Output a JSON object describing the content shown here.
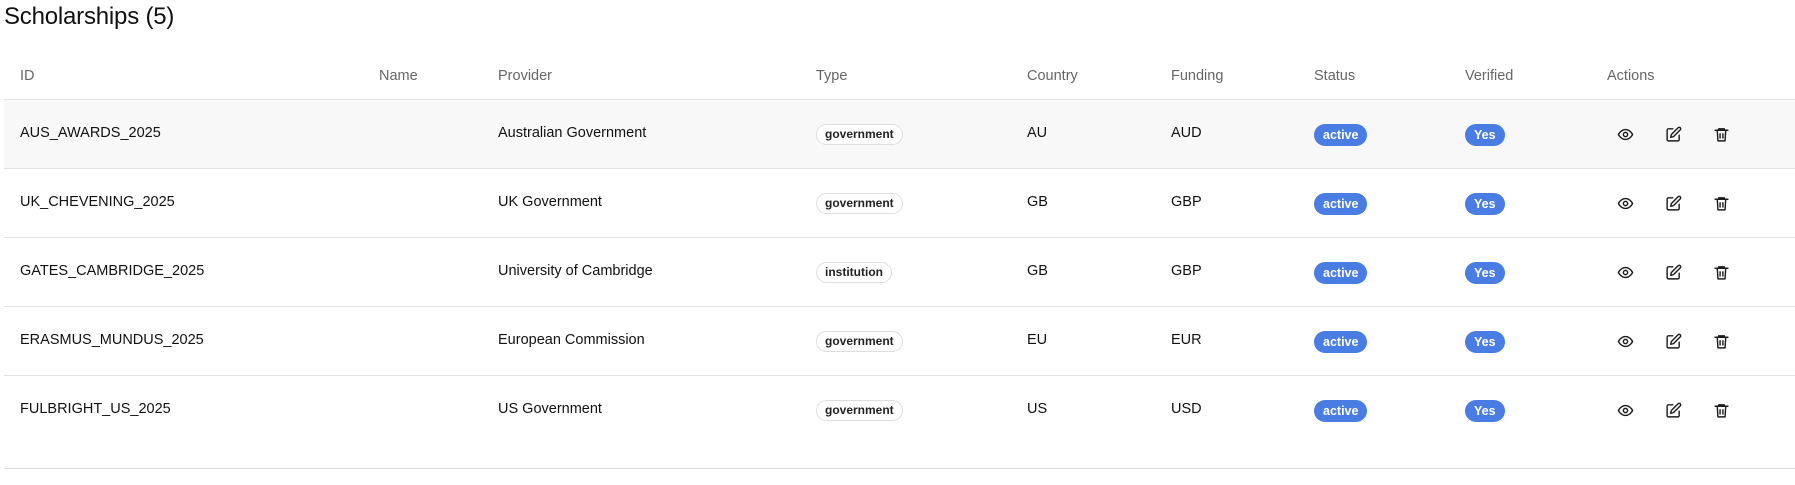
{
  "page": {
    "title": "Scholarships (5)"
  },
  "table": {
    "columns": {
      "id": "ID",
      "name": "Name",
      "provider": "Provider",
      "type": "Type",
      "country": "Country",
      "funding": "Funding",
      "status": "Status",
      "verified": "Verified",
      "actions": "Actions"
    },
    "rows": [
      {
        "id": "AUS_AWARDS_2025",
        "name": "",
        "provider": "Australian Government",
        "type": "government",
        "country": "AU",
        "funding": "AUD",
        "status": "active",
        "verified": "Yes"
      },
      {
        "id": "UK_CHEVENING_2025",
        "name": "",
        "provider": "UK Government",
        "type": "government",
        "country": "GB",
        "funding": "GBP",
        "status": "active",
        "verified": "Yes"
      },
      {
        "id": "GATES_CAMBRIDGE_2025",
        "name": "",
        "provider": "University of Cambridge",
        "type": "institution",
        "country": "GB",
        "funding": "GBP",
        "status": "active",
        "verified": "Yes"
      },
      {
        "id": "ERASMUS_MUNDUS_2025",
        "name": "",
        "provider": "European Commission",
        "type": "government",
        "country": "EU",
        "funding": "EUR",
        "status": "active",
        "verified": "Yes"
      },
      {
        "id": "FULBRIGHT_US_2025",
        "name": "",
        "provider": "US Government",
        "type": "government",
        "country": "US",
        "funding": "USD",
        "status": "active",
        "verified": "Yes"
      }
    ],
    "row_actions": [
      "eye-icon",
      "edit-icon",
      "trash-icon"
    ]
  },
  "colors": {
    "accent": "#4a7de4",
    "header_text": "#666666",
    "row_highlight": "#f8f8f8",
    "divider": "#e2e2e2"
  }
}
